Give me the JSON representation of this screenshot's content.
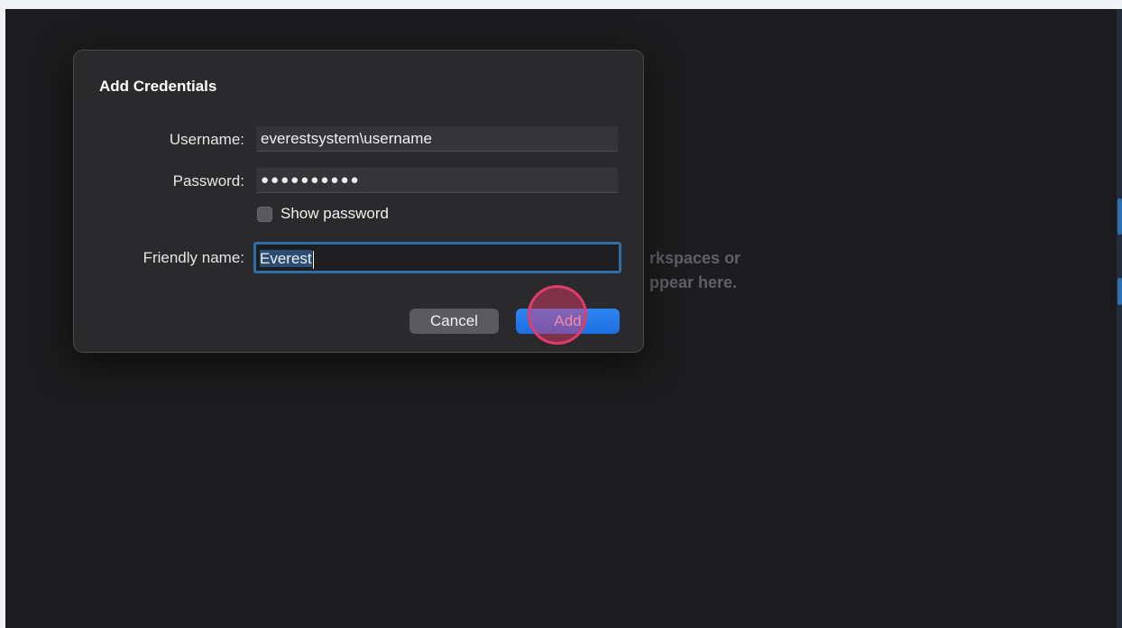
{
  "background_message": {
    "line1": "rkspaces or",
    "line2": "ppear here."
  },
  "dialog": {
    "title": "Add Credentials",
    "username": {
      "label": "Username:",
      "value": "everestsystem\\username"
    },
    "password": {
      "label": "Password:",
      "value": "●●●●●●●●●●"
    },
    "show_password": {
      "label": "Show password",
      "checked": false
    },
    "friendly_name": {
      "label": "Friendly name:",
      "value": "Everest"
    },
    "buttons": {
      "cancel": "Cancel",
      "add": "Add"
    }
  },
  "colors": {
    "accent": "#2f86f2",
    "click_indicator": "#e23c6b",
    "window_background": "#1c1c1e"
  }
}
